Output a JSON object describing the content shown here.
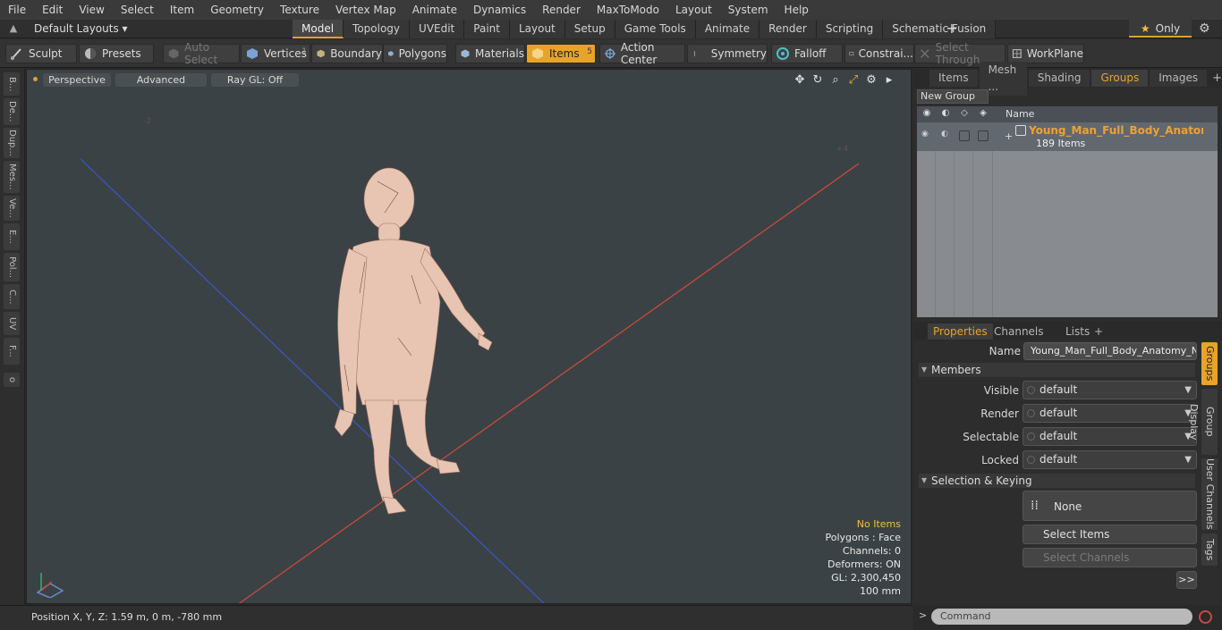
{
  "menu": [
    "File",
    "Edit",
    "View",
    "Select",
    "Item",
    "Geometry",
    "Texture",
    "Vertex Map",
    "Animate",
    "Dynamics",
    "Render",
    "MaxToModo",
    "Layout",
    "System",
    "Help"
  ],
  "layoutbar": {
    "layout_label": "Default Layouts ▾",
    "tabs": [
      "Model",
      "Topology",
      "UVEdit",
      "Paint",
      "Layout",
      "Setup",
      "Game Tools",
      "Animate",
      "Render",
      "Scripting",
      "Schematic Fusion"
    ],
    "active_tab": "Model",
    "only_label": "Only"
  },
  "toolbar": {
    "sculpt": "Sculpt",
    "presets": "Presets",
    "auto_select": "Auto Select",
    "vertices": "Vertices",
    "vertices_count": "1",
    "boundary": "Boundary",
    "polygons": "Polygons",
    "materials": "Materials",
    "items": "Items",
    "items_count": "5",
    "action_center": "Action Center",
    "symmetry": "Symmetry",
    "falloff": "Falloff",
    "constraints": "Constrai...",
    "select_through": "Select Through",
    "workplane": "WorkPlane"
  },
  "left_strip": [
    "B...",
    "De...",
    "Dup...",
    "Mes...",
    "Ve...",
    "E...",
    "Pol...",
    "C...",
    "UV",
    "F..."
  ],
  "viewport": {
    "perspective": "Perspective",
    "advanced": "Advanced",
    "raygl": "Ray GL: Off",
    "stats": {
      "no_items": "No Items",
      "polygons": "Polygons : Face",
      "channels": "Channels: 0",
      "deformers": "Deformers: ON",
      "gl": "GL: 2,300,450",
      "scale": "100 mm"
    }
  },
  "status": {
    "position": "Position X, Y, Z:   1.59 m, 0 m, -780 mm"
  },
  "right_tabs": [
    "Items",
    "Mesh ...",
    "Shading",
    "Groups",
    "Images"
  ],
  "right_active": "Groups",
  "groups": {
    "new_group": "New Group",
    "col_name": "Name",
    "item_name": "Young_Man_Full_Body_Anatom ...",
    "item_count": "189 Items"
  },
  "props_tabs": [
    "Properties",
    "Channels",
    "Lists"
  ],
  "props": {
    "name_label": "Name",
    "name_value": "Young_Man_Full_Body_Anatomy_Naked",
    "members": "Members",
    "visible_label": "Visible",
    "render_label": "Render",
    "selectable_label": "Selectable",
    "locked_label": "Locked",
    "default_value": "default",
    "selection_keying": "Selection & Keying",
    "none": "None",
    "select_items": "Select Items",
    "select_channels": "Select Channels",
    "more": ">>"
  },
  "side_tabs": [
    "Groups",
    "Group Display",
    "User Channels",
    "Tags"
  ],
  "command_placeholder": "Command",
  "colors": {
    "accent": "#e8a32a",
    "viewport_bg": "#3b4245",
    "grid_x": "#d04a3a",
    "grid_z": "#3a56c8"
  }
}
